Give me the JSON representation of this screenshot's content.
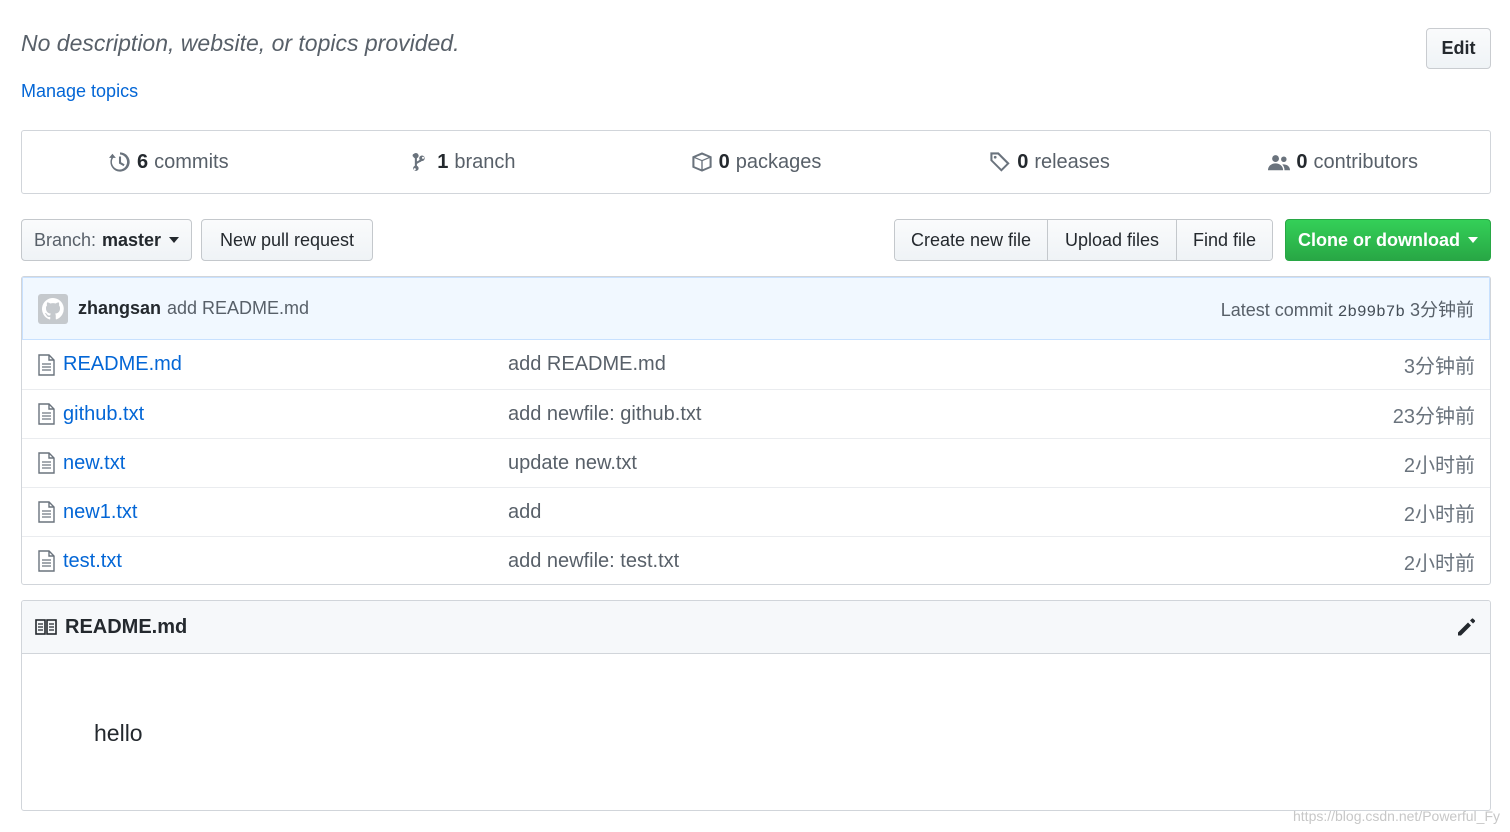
{
  "repo": {
    "description": "No description, website, or topics provided.",
    "edit_label": "Edit",
    "manage_topics_label": "Manage topics"
  },
  "summary": [
    {
      "icon": "history-icon",
      "count": "6",
      "label": "commits"
    },
    {
      "icon": "git-branch-icon",
      "count": "1",
      "label": "branch"
    },
    {
      "icon": "package-icon",
      "count": "0",
      "label": "packages"
    },
    {
      "icon": "tag-icon",
      "count": "0",
      "label": "releases"
    },
    {
      "icon": "people-icon",
      "count": "0",
      "label": "contributors"
    }
  ],
  "toolbar": {
    "branch_label": "Branch:",
    "branch_value": "master",
    "new_pull_request": "New pull request",
    "create_new_file": "Create new file",
    "upload_files": "Upload files",
    "find_file": "Find file",
    "clone_or_download": "Clone or download"
  },
  "latest_commit": {
    "author": "zhangsan",
    "message": "add README.md",
    "label": "Latest commit",
    "sha": "2b99b7b",
    "age": "3分钟前"
  },
  "files": [
    {
      "name": "README.md",
      "message": "add README.md",
      "age": "3分钟前"
    },
    {
      "name": "github.txt",
      "message": "add newfile: github.txt",
      "age": "23分钟前"
    },
    {
      "name": "new.txt",
      "message": "update new.txt",
      "age": "2小时前"
    },
    {
      "name": "new1.txt",
      "message": "add",
      "age": "2小时前"
    },
    {
      "name": "test.txt",
      "message": "add newfile: test.txt",
      "age": "2小时前"
    }
  ],
  "readme": {
    "title": "README.md",
    "content": "hello"
  },
  "watermark": "https://blog.csdn.net/Powerful_Fy",
  "colors": {
    "link": "#0366d6",
    "clone_green": "#28a745",
    "commit_bar": "#f1f8ff"
  }
}
